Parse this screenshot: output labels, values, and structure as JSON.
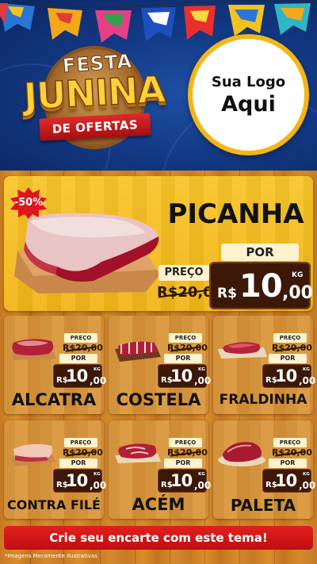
{
  "header": {
    "festa": "FESTA",
    "junina": "JUNINA",
    "de_ofertas": "DE OFERTAS",
    "logo_line1": "Sua Logo",
    "logo_line2": "Aqui"
  },
  "featured": {
    "discount": "-50%",
    "name": "PICANHA",
    "preco_label": "PREÇO",
    "old_price": "R$20,00",
    "por_label": "POR",
    "currency": "R$",
    "price_int": "10",
    "price_cents": ",00",
    "unit": "KG"
  },
  "products": [
    {
      "name": "ALCATRA",
      "preco_label": "PREÇO",
      "old_price": "R$20,00",
      "por_label": "POR",
      "currency": "R$",
      "price_int": "10",
      "price_cents": ",00",
      "unit": "KG"
    },
    {
      "name": "COSTELA",
      "preco_label": "PREÇO",
      "old_price": "R$20,00",
      "por_label": "POR",
      "currency": "R$",
      "price_int": "10",
      "price_cents": ",00",
      "unit": "KG"
    },
    {
      "name": "FRALDINHA",
      "preco_label": "PREÇO",
      "old_price": "R$20,00",
      "por_label": "POR",
      "currency": "R$",
      "price_int": "10",
      "price_cents": ",00",
      "unit": "KG"
    },
    {
      "name": "CONTRA FILÉ",
      "preco_label": "PREÇO",
      "old_price": "R$20,00",
      "por_label": "POR",
      "currency": "R$",
      "price_int": "10",
      "price_cents": ",00",
      "unit": "KG"
    },
    {
      "name": "ACÉM",
      "preco_label": "PREÇO",
      "old_price": "R$20,00",
      "por_label": "POR",
      "currency": "R$",
      "price_int": "10",
      "price_cents": ",00",
      "unit": "KG"
    },
    {
      "name": "PALETA",
      "preco_label": "PREÇO",
      "old_price": "R$20,00",
      "por_label": "POR",
      "currency": "R$",
      "price_int": "10",
      "price_cents": ",00",
      "unit": "KG"
    }
  ],
  "cta": "Crie seu encarte com este tema!",
  "disclaimer": "*Imagens Meramente Ilustrativas",
  "colors": {
    "header_bg": "#133a86",
    "wood": "#d38a2d",
    "featured_card": "#f5bf22",
    "price_box": "#3b1808",
    "cta": "#d21818",
    "discount_badge": "#e0141c"
  }
}
